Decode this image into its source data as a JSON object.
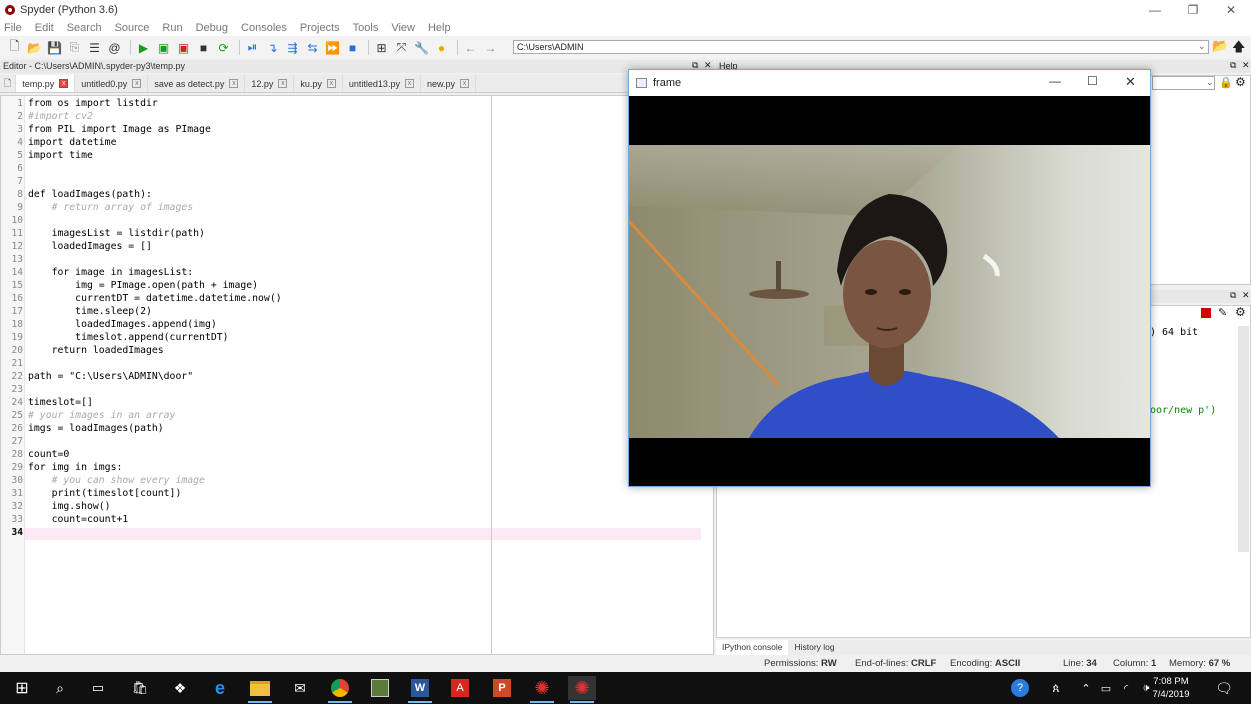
{
  "window": {
    "title": "Spyder (Python 3.6)"
  },
  "menu": [
    "File",
    "Edit",
    "Search",
    "Source",
    "Run",
    "Debug",
    "Consoles",
    "Projects",
    "Tools",
    "View",
    "Help"
  ],
  "toolbar": {
    "path": "C:\\Users\\ADMIN"
  },
  "editor": {
    "header": "Editor - C:\\Users\\ADMIN\\.spyder-py3\\temp.py",
    "tabs": [
      "temp.py",
      "untitled0.py",
      "save as detect.py",
      "12.py",
      "ku.py",
      "untitled13.py",
      "new.py"
    ],
    "lines": [
      {
        "n": "1",
        "text": "from os import listdir"
      },
      {
        "n": "2",
        "text": "#import cv2"
      },
      {
        "n": "3",
        "text": "from PIL import Image as PImage"
      },
      {
        "n": "4",
        "text": "import datetime"
      },
      {
        "n": "5",
        "text": "import time"
      },
      {
        "n": "6",
        "text": ""
      },
      {
        "n": "7",
        "text": ""
      },
      {
        "n": "8",
        "text": "def loadImages(path):"
      },
      {
        "n": "9",
        "text": "    # return array of images"
      },
      {
        "n": "10",
        "text": ""
      },
      {
        "n": "11",
        "text": "    imagesList = listdir(path)"
      },
      {
        "n": "12",
        "text": "    loadedImages = []"
      },
      {
        "n": "13",
        "text": ""
      },
      {
        "n": "14",
        "text": "    for image in imagesList:"
      },
      {
        "n": "15",
        "text": "        img = PImage.open(path + image)"
      },
      {
        "n": "16",
        "text": "        currentDT = datetime.datetime.now()"
      },
      {
        "n": "17",
        "text": "        time.sleep(2)"
      },
      {
        "n": "18",
        "text": "        loadedImages.append(img)"
      },
      {
        "n": "19",
        "text": "        timeslot.append(currentDT)"
      },
      {
        "n": "20",
        "text": "    return loadedImages"
      },
      {
        "n": "21",
        "text": ""
      },
      {
        "n": "22",
        "text": "path = \"C:\\Users\\ADMIN\\door\""
      },
      {
        "n": "23",
        "text": ""
      },
      {
        "n": "24",
        "text": "timeslot=[]"
      },
      {
        "n": "25",
        "text": "# your images in an array"
      },
      {
        "n": "26",
        "text": "imgs = loadImages(path)"
      },
      {
        "n": "27",
        "text": ""
      },
      {
        "n": "28",
        "text": "count=0"
      },
      {
        "n": "29",
        "text": "for img in imgs:"
      },
      {
        "n": "30",
        "text": "    # you can show every image"
      },
      {
        "n": "31",
        "text": "    print(timeslot[count])"
      },
      {
        "n": "32",
        "text": "    img.show()"
      },
      {
        "n": "33",
        "text": "    count=count+1"
      },
      {
        "n": "34",
        "text": ""
      }
    ]
  },
  "help": {
    "header": "Help"
  },
  "console": {
    "fragment1": ") 64 bit",
    "fragment2": "oor/new p')",
    "tabs": [
      "IPython console",
      "History log"
    ]
  },
  "status": {
    "permissions_label": "Permissions:",
    "permissions": "RW",
    "eol_label": "End-of-lines:",
    "eol": "CRLF",
    "encoding_label": "Encoding:",
    "encoding": "ASCII",
    "line_label": "Line:",
    "line": "34",
    "column_label": "Column:",
    "column": "1",
    "memory_label": "Memory:",
    "memory": "67 %"
  },
  "frame": {
    "title": "frame"
  },
  "taskbar": {
    "time": "7:08 PM",
    "date": "7/4/2019"
  },
  "colors": {
    "accent": "#76b9ed",
    "current_line": "#fbeaf5",
    "keyword": "#0000c0"
  }
}
